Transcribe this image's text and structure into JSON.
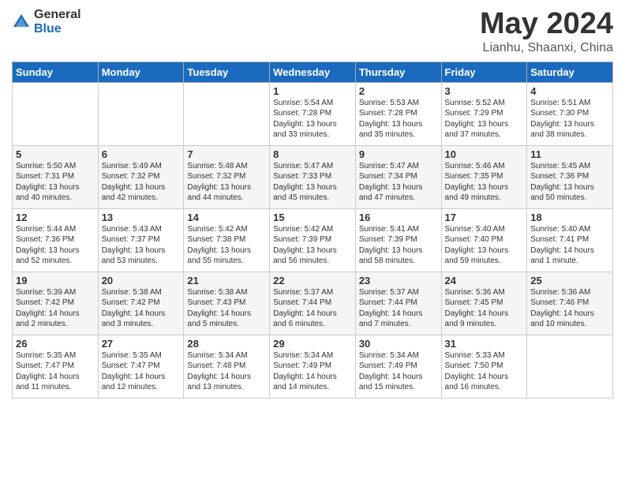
{
  "header": {
    "logo_general": "General",
    "logo_blue": "Blue",
    "month": "May 2024",
    "location": "Lianhu, Shaanxi, China"
  },
  "weekdays": [
    "Sunday",
    "Monday",
    "Tuesday",
    "Wednesday",
    "Thursday",
    "Friday",
    "Saturday"
  ],
  "weeks": [
    [
      {
        "day": "",
        "info": ""
      },
      {
        "day": "",
        "info": ""
      },
      {
        "day": "",
        "info": ""
      },
      {
        "day": "1",
        "info": "Sunrise: 5:54 AM\nSunset: 7:28 PM\nDaylight: 13 hours\nand 33 minutes."
      },
      {
        "day": "2",
        "info": "Sunrise: 5:53 AM\nSunset: 7:28 PM\nDaylight: 13 hours\nand 35 minutes."
      },
      {
        "day": "3",
        "info": "Sunrise: 5:52 AM\nSunset: 7:29 PM\nDaylight: 13 hours\nand 37 minutes."
      },
      {
        "day": "4",
        "info": "Sunrise: 5:51 AM\nSunset: 7:30 PM\nDaylight: 13 hours\nand 38 minutes."
      }
    ],
    [
      {
        "day": "5",
        "info": "Sunrise: 5:50 AM\nSunset: 7:31 PM\nDaylight: 13 hours\nand 40 minutes."
      },
      {
        "day": "6",
        "info": "Sunrise: 5:49 AM\nSunset: 7:32 PM\nDaylight: 13 hours\nand 42 minutes."
      },
      {
        "day": "7",
        "info": "Sunrise: 5:48 AM\nSunset: 7:32 PM\nDaylight: 13 hours\nand 44 minutes."
      },
      {
        "day": "8",
        "info": "Sunrise: 5:47 AM\nSunset: 7:33 PM\nDaylight: 13 hours\nand 45 minutes."
      },
      {
        "day": "9",
        "info": "Sunrise: 5:47 AM\nSunset: 7:34 PM\nDaylight: 13 hours\nand 47 minutes."
      },
      {
        "day": "10",
        "info": "Sunrise: 5:46 AM\nSunset: 7:35 PM\nDaylight: 13 hours\nand 49 minutes."
      },
      {
        "day": "11",
        "info": "Sunrise: 5:45 AM\nSunset: 7:36 PM\nDaylight: 13 hours\nand 50 minutes."
      }
    ],
    [
      {
        "day": "12",
        "info": "Sunrise: 5:44 AM\nSunset: 7:36 PM\nDaylight: 13 hours\nand 52 minutes."
      },
      {
        "day": "13",
        "info": "Sunrise: 5:43 AM\nSunset: 7:37 PM\nDaylight: 13 hours\nand 53 minutes."
      },
      {
        "day": "14",
        "info": "Sunrise: 5:42 AM\nSunset: 7:38 PM\nDaylight: 13 hours\nand 55 minutes."
      },
      {
        "day": "15",
        "info": "Sunrise: 5:42 AM\nSunset: 7:39 PM\nDaylight: 13 hours\nand 56 minutes."
      },
      {
        "day": "16",
        "info": "Sunrise: 5:41 AM\nSunset: 7:39 PM\nDaylight: 13 hours\nand 58 minutes."
      },
      {
        "day": "17",
        "info": "Sunrise: 5:40 AM\nSunset: 7:40 PM\nDaylight: 13 hours\nand 59 minutes."
      },
      {
        "day": "18",
        "info": "Sunrise: 5:40 AM\nSunset: 7:41 PM\nDaylight: 14 hours\nand 1 minute."
      }
    ],
    [
      {
        "day": "19",
        "info": "Sunrise: 5:39 AM\nSunset: 7:42 PM\nDaylight: 14 hours\nand 2 minutes."
      },
      {
        "day": "20",
        "info": "Sunrise: 5:38 AM\nSunset: 7:42 PM\nDaylight: 14 hours\nand 3 minutes."
      },
      {
        "day": "21",
        "info": "Sunrise: 5:38 AM\nSunset: 7:43 PM\nDaylight: 14 hours\nand 5 minutes."
      },
      {
        "day": "22",
        "info": "Sunrise: 5:37 AM\nSunset: 7:44 PM\nDaylight: 14 hours\nand 6 minutes."
      },
      {
        "day": "23",
        "info": "Sunrise: 5:37 AM\nSunset: 7:44 PM\nDaylight: 14 hours\nand 7 minutes."
      },
      {
        "day": "24",
        "info": "Sunrise: 5:36 AM\nSunset: 7:45 PM\nDaylight: 14 hours\nand 9 minutes."
      },
      {
        "day": "25",
        "info": "Sunrise: 5:36 AM\nSunset: 7:46 PM\nDaylight: 14 hours\nand 10 minutes."
      }
    ],
    [
      {
        "day": "26",
        "info": "Sunrise: 5:35 AM\nSunset: 7:47 PM\nDaylight: 14 hours\nand 11 minutes."
      },
      {
        "day": "27",
        "info": "Sunrise: 5:35 AM\nSunset: 7:47 PM\nDaylight: 14 hours\nand 12 minutes."
      },
      {
        "day": "28",
        "info": "Sunrise: 5:34 AM\nSunset: 7:48 PM\nDaylight: 14 hours\nand 13 minutes."
      },
      {
        "day": "29",
        "info": "Sunrise: 5:34 AM\nSunset: 7:49 PM\nDaylight: 14 hours\nand 14 minutes."
      },
      {
        "day": "30",
        "info": "Sunrise: 5:34 AM\nSunset: 7:49 PM\nDaylight: 14 hours\nand 15 minutes."
      },
      {
        "day": "31",
        "info": "Sunrise: 5:33 AM\nSunset: 7:50 PM\nDaylight: 14 hours\nand 16 minutes."
      },
      {
        "day": "",
        "info": ""
      }
    ]
  ]
}
